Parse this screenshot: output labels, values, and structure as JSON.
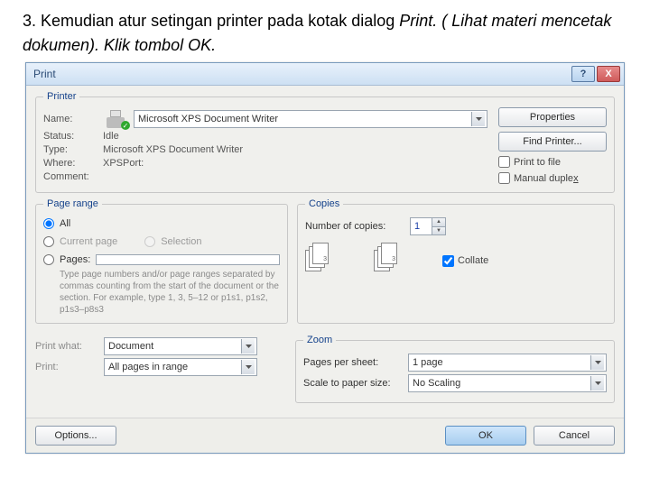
{
  "instruction": {
    "prefix": "3. Kemudian atur setingan printer pada kotak dialog ",
    "italic1": "Print. ( Lihat materi mencetak dokumen). ",
    "tail": "Klik tombol OK."
  },
  "dialog": {
    "title": "Print",
    "help_btn": "?",
    "close_btn": "X"
  },
  "printer": {
    "legend": "Printer",
    "name_label": "Name:",
    "name_value": "Microsoft XPS Document Writer",
    "status_label": "Status:",
    "status_value": "Idle",
    "type_label": "Type:",
    "type_value": "Microsoft XPS Document Writer",
    "where_label": "Where:",
    "where_value": "XPSPort:",
    "comment_label": "Comment:",
    "properties_btn": "Properties",
    "find_printer_btn": "Find Printer...",
    "print_to_file": "Print to file",
    "manual_duplex": "Manual duplex"
  },
  "page_range": {
    "legend": "Page range",
    "all": "All",
    "current_page": "Current page",
    "selection": "Selection",
    "pages": "Pages:",
    "pages_value": "",
    "help": "Type page numbers and/or page ranges separated by commas counting from the start of the document or the section. For example, type 1, 3, 5–12 or p1s1, p1s2, p1s3–p8s3"
  },
  "copies": {
    "legend": "Copies",
    "num_label": "Number of copies:",
    "num_value": "1",
    "collate": "Collate"
  },
  "print_what": {
    "label": "Print what:",
    "value": "Document",
    "print_label": "Print:",
    "print_value": "All pages in range"
  },
  "zoom": {
    "legend": "Zoom",
    "pps_label": "Pages per sheet:",
    "pps_value": "1 page",
    "scale_label": "Scale to paper size:",
    "scale_value": "No Scaling"
  },
  "footer": {
    "options": "Options...",
    "ok": "OK",
    "cancel": "Cancel"
  }
}
